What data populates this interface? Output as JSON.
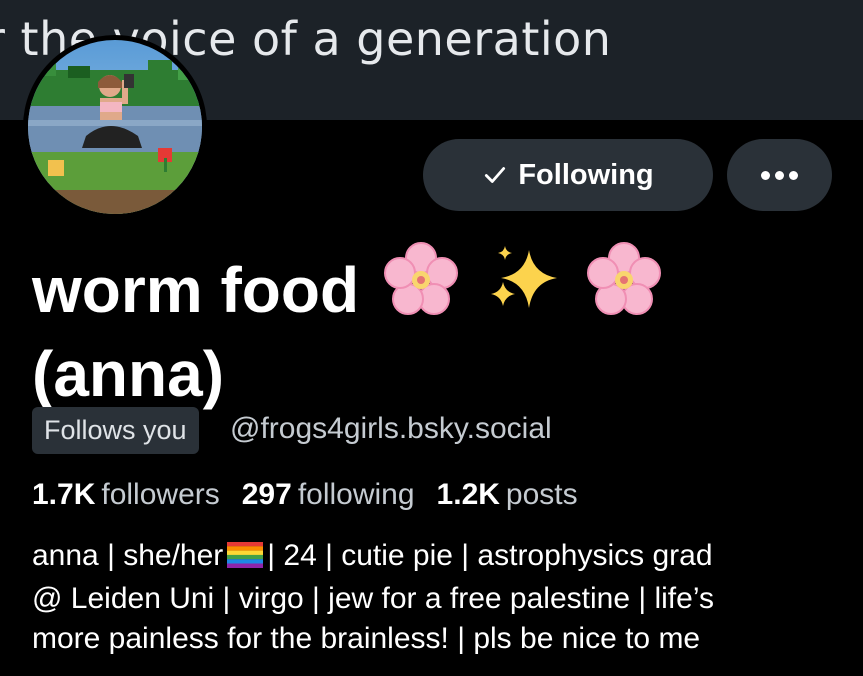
{
  "banner": {
    "text": "r the voice of a generation"
  },
  "profile": {
    "avatar_icon": "profile-photo",
    "display_name_line1": "worm food",
    "display_name_line2": "(anna)",
    "name_emojis": [
      "cherry-blossom",
      "sparkles",
      "cherry-blossom"
    ],
    "follows_you_label": "Follows you",
    "handle": "@frogs4girls.bsky.social"
  },
  "actions": {
    "following_label": "Following",
    "following_icon": "check-icon",
    "more_icon": "ellipsis-icon"
  },
  "stats": [
    {
      "count": "1.7K",
      "label": "followers"
    },
    {
      "count": "297",
      "label": "following"
    },
    {
      "count": "1.2K",
      "label": "posts"
    }
  ],
  "bio": {
    "line1_before_flag": "anna | she/her",
    "line1_after_flag": "| 24 | cutie pie | astrophysics grad",
    "line2": "@ Leiden Uni | virgo | jew for a free palestine | life’s",
    "line3": "more painless for the brainless! | pls be nice to me",
    "flag_icon": "rainbow-flag"
  },
  "colors": {
    "background": "#000000",
    "banner": "#1c2228",
    "button": "#2a3138",
    "secondary_text": "#c5cbd1"
  }
}
